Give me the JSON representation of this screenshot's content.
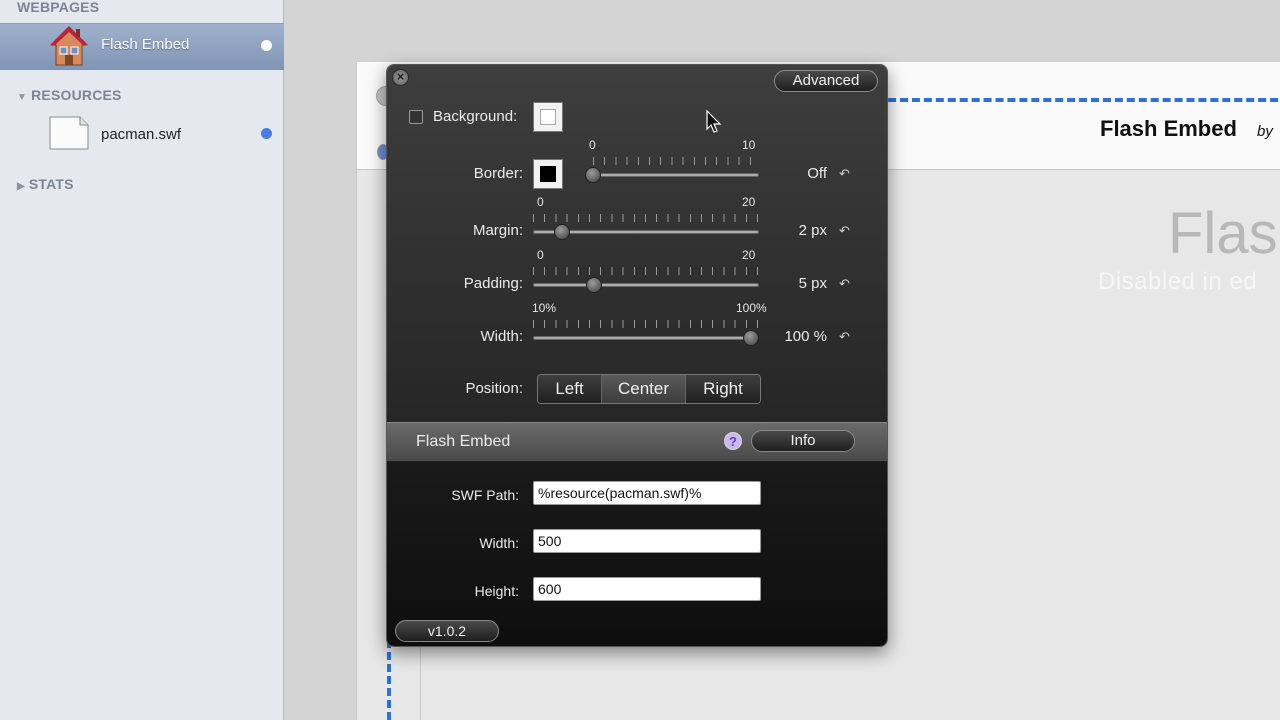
{
  "sidebar": {
    "webpages_heading": "WEBPAGES",
    "selected_page": "Flash Embed",
    "resources_heading": "RESOURCES",
    "resource_file": "pacman.swf",
    "stats_heading": "STATS",
    "dot_color": "#4b7de3"
  },
  "page": {
    "site_title": "Flash Embed",
    "site_by": "by",
    "big_text": "Flas",
    "disabled_text": "Disabled in ed",
    "selection_color": "#2f6fd9"
  },
  "hud": {
    "advanced_label": "Advanced",
    "background_label": "Background:",
    "border_label": "Border:",
    "margin_label": "Margin:",
    "padding_label": "Padding:",
    "width_label": "Width:",
    "position_label": "Position:",
    "border_slider": {
      "min": "0",
      "max": "10",
      "value": 0,
      "value_text": "Off"
    },
    "margin_slider": {
      "min": "0",
      "max": "20",
      "value": 2,
      "value_text": "2 px"
    },
    "padding_slider": {
      "min": "0",
      "max": "20",
      "value": 5,
      "value_text": "5 px"
    },
    "width_slider": {
      "min": "10%",
      "max": "100%",
      "value": 100,
      "value_text": "100 %"
    },
    "position_options": [
      "Left",
      "Center",
      "Right"
    ],
    "position_selected": "Center",
    "section_title": "Flash Embed",
    "info_label": "Info",
    "swf_path_label": "SWF Path:",
    "swf_path_value": "%resource(pacman.swf)%",
    "plugin_width_label": "Width:",
    "plugin_width_value": "500",
    "plugin_height_label": "Height:",
    "plugin_height_value": "600",
    "version_label": "v1.0.2"
  }
}
